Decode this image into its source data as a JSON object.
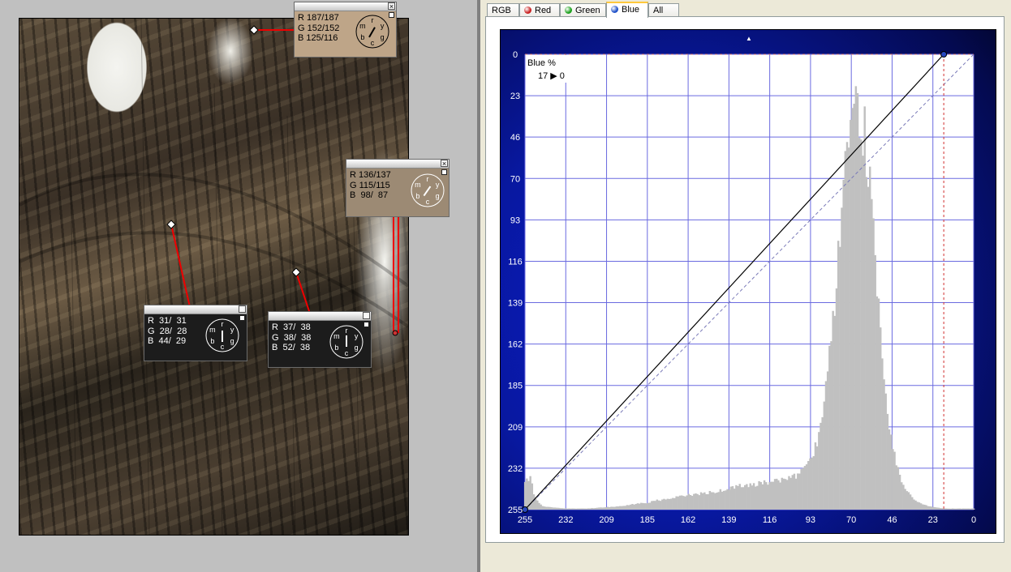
{
  "tabs": [
    {
      "label": "RGB",
      "dot": null,
      "active": false
    },
    {
      "label": "Red",
      "dot": "#c81e1e",
      "active": false
    },
    {
      "label": "Green",
      "dot": "#1aa01a",
      "active": false
    },
    {
      "label": "Blue",
      "dot": "#1e50c8",
      "active": true
    },
    {
      "label": "All",
      "dot": null,
      "active": false
    }
  ],
  "probes": [
    {
      "r": "187/187",
      "g": "152/152",
      "b": "125/116",
      "theme": "light"
    },
    {
      "r": "136/137",
      "g": "115/115",
      "b": " 98/  87",
      "theme": "light2"
    },
    {
      "r": " 31/  31",
      "g": " 28/  28",
      "b": " 44/  29",
      "theme": "dark"
    },
    {
      "r": " 37/  38",
      "g": " 38/  38",
      "b": " 52/  38",
      "theme": "dark"
    }
  ],
  "dial_letters": [
    "r",
    "y",
    "g",
    "c",
    "b",
    "m"
  ],
  "chart_data": {
    "type": "area",
    "channel_label": "Blue %",
    "point_readout": "17 ▶ 0",
    "x_ticks": [
      255,
      232,
      209,
      185,
      162,
      139,
      116,
      93,
      70,
      46,
      23,
      0
    ],
    "y_ticks": [
      0,
      23,
      46,
      70,
      93,
      116,
      139,
      162,
      185,
      209,
      232,
      255
    ],
    "xlim": [
      255,
      0
    ],
    "ylim": [
      0,
      255
    ],
    "grid": true,
    "curve": [
      {
        "x": 255,
        "y": 255
      },
      {
        "x": 17,
        "y": 0
      }
    ],
    "reference_line": [
      {
        "x": 255,
        "y": 255
      },
      {
        "x": 0,
        "y": 0
      }
    ],
    "marker_x": 17,
    "histogram": [
      [
        255,
        22
      ],
      [
        252,
        30
      ],
      [
        250,
        14
      ],
      [
        248,
        8
      ],
      [
        245,
        3
      ],
      [
        240,
        2
      ],
      [
        232,
        1
      ],
      [
        220,
        1
      ],
      [
        210,
        2
      ],
      [
        200,
        3
      ],
      [
        192,
        5
      ],
      [
        186,
        6
      ],
      [
        180,
        8
      ],
      [
        175,
        9
      ],
      [
        170,
        11
      ],
      [
        165,
        12
      ],
      [
        160,
        13
      ],
      [
        155,
        14
      ],
      [
        150,
        15
      ],
      [
        145,
        16
      ],
      [
        140,
        18
      ],
      [
        135,
        20
      ],
      [
        130,
        21
      ],
      [
        125,
        22
      ],
      [
        120,
        23
      ],
      [
        115,
        24
      ],
      [
        110,
        25
      ],
      [
        105,
        27
      ],
      [
        100,
        30
      ],
      [
        96,
        35
      ],
      [
        92,
        45
      ],
      [
        89,
        60
      ],
      [
        86,
        80
      ],
      [
        83,
        115
      ],
      [
        80,
        165
      ],
      [
        78,
        205
      ],
      [
        76,
        245
      ],
      [
        74,
        270
      ],
      [
        72,
        300
      ],
      [
        70,
        330
      ],
      [
        68,
        345
      ],
      [
        66,
        355
      ],
      [
        64,
        350
      ],
      [
        62,
        330
      ],
      [
        60,
        300
      ],
      [
        58,
        260
      ],
      [
        56,
        220
      ],
      [
        54,
        180
      ],
      [
        52,
        140
      ],
      [
        50,
        105
      ],
      [
        48,
        75
      ],
      [
        46,
        55
      ],
      [
        44,
        40
      ],
      [
        42,
        30
      ],
      [
        40,
        22
      ],
      [
        38,
        16
      ],
      [
        36,
        12
      ],
      [
        33,
        8
      ],
      [
        30,
        5
      ],
      [
        26,
        3
      ],
      [
        22,
        2
      ],
      [
        17,
        1
      ],
      [
        10,
        1
      ],
      [
        0,
        1
      ]
    ]
  }
}
